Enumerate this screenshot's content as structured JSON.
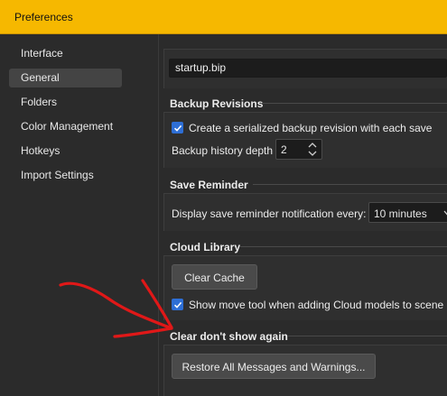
{
  "window": {
    "title": "Preferences"
  },
  "sidebar": {
    "items": [
      {
        "label": "Interface",
        "active": false
      },
      {
        "label": "General",
        "active": true
      },
      {
        "label": "Folders",
        "active": false
      },
      {
        "label": "Color Management",
        "active": false
      },
      {
        "label": "Hotkeys",
        "active": false
      },
      {
        "label": "Import Settings",
        "active": false
      }
    ]
  },
  "startup_file": {
    "value": "startup.bip"
  },
  "backup_revisions": {
    "title": "Backup Revisions",
    "create_backup_label": "Create a serialized backup revision with each save",
    "create_backup_checked": true,
    "history_depth_label": "Backup history depth",
    "history_depth_value": "2"
  },
  "save_reminder": {
    "title": "Save Reminder",
    "label": "Display save reminder notification every:",
    "interval_value": "10 minutes"
  },
  "cloud_library": {
    "title": "Cloud Library",
    "clear_cache_label": "Clear Cache",
    "show_move_tool_label": "Show move tool when adding Cloud models to scene",
    "show_move_tool_checked": true
  },
  "clear_dont_show": {
    "title": "Clear don't show again",
    "restore_label": "Restore All Messages and Warnings..."
  },
  "colors": {
    "titlebar": "#f6b800",
    "accent": "#2e6fd6",
    "annotation": "#e01818"
  },
  "icons": [
    "check-icon",
    "spin-up-icon",
    "spin-down-icon",
    "chevron-down-icon",
    "red-arrow-annotation"
  ]
}
